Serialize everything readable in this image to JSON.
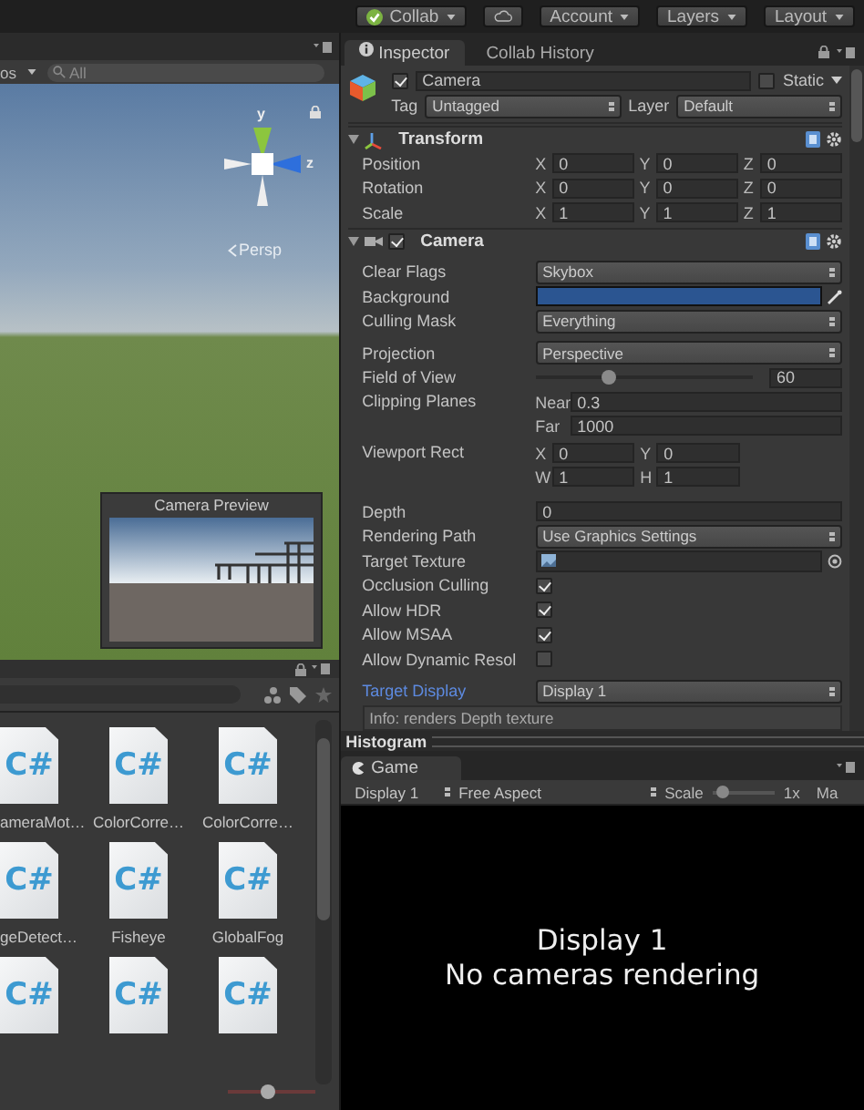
{
  "toolbar": [
    {
      "kind": "collab",
      "label": "Collab"
    },
    {
      "kind": "cloud"
    },
    {
      "kind": "menu",
      "label": "Account"
    },
    {
      "kind": "menu",
      "label": "Layers"
    },
    {
      "kind": "menu",
      "label": "Layout"
    }
  ],
  "scene": {
    "gizmos": "os",
    "search_placeholder": "All",
    "axes": [
      {
        "label": "y",
        "color": "#8cc63e"
      },
      {
        "label": "z",
        "color": "#2e6fdc"
      }
    ],
    "projection": "Persp",
    "preview_title": "Camera Preview"
  },
  "project": {
    "icon_size": {
      "level": 0.45
    },
    "files": [
      {
        "badge": "C#",
        "name": "ameraMot…"
      },
      {
        "badge": "C#",
        "name": "ColorCorre…"
      },
      {
        "badge": "C#",
        "name": "ColorCorre…"
      },
      {
        "badge": "C#",
        "name": "geDetect…"
      },
      {
        "badge": "C#",
        "name": "Fisheye"
      },
      {
        "badge": "C#",
        "name": "GlobalFog"
      },
      {
        "badge": "C#"
      },
      {
        "badge": "C#"
      },
      {
        "badge": "C#"
      }
    ]
  },
  "inspector": {
    "tabs": [
      {
        "label": "Inspector",
        "selected": true
      },
      {
        "label": "Collab History",
        "selected": false
      }
    ],
    "object": {
      "active": true,
      "name": "Camera",
      "static_label": "Static",
      "static": false,
      "tag_label": "Tag",
      "tag": "Untagged",
      "layer_label": "Layer",
      "layer": "Default"
    },
    "transform": {
      "title": "Transform",
      "expanded": true,
      "rows": [
        {
          "label": "Position",
          "fields": [
            {
              "axis": "X",
              "value": "0"
            },
            {
              "axis": "Y",
              "value": "0"
            },
            {
              "axis": "Z",
              "value": "0"
            }
          ]
        },
        {
          "label": "Rotation",
          "fields": [
            {
              "axis": "X",
              "value": "0"
            },
            {
              "axis": "Y",
              "value": "0"
            },
            {
              "axis": "Z",
              "value": "0"
            }
          ]
        },
        {
          "label": "Scale",
          "fields": [
            {
              "axis": "X",
              "value": "1"
            },
            {
              "axis": "Y",
              "value": "1"
            },
            {
              "axis": "Z",
              "value": "1"
            }
          ]
        }
      ]
    },
    "camera": {
      "title": "Camera",
      "expanded": true,
      "enabled": true,
      "groups": [
        {
          "rows": [
            {
              "kind": "dropdown",
              "label": "Clear Flags",
              "value": "Skybox"
            },
            {
              "kind": "color",
              "label": "Background",
              "color": "#2b5591"
            },
            {
              "kind": "dropdown",
              "label": "Culling Mask",
              "value": "Everything"
            }
          ]
        },
        {
          "rows": [
            {
              "kind": "dropdown",
              "label": "Projection",
              "value": "Perspective"
            },
            {
              "kind": "slider",
              "label": "Field of View",
              "level": 0.34,
              "value": "60"
            },
            {
              "kind": "stack",
              "label": "Clipping Planes",
              "fields": [
                {
                  "axis": "Near",
                  "value": "0.3"
                },
                {
                  "axis": "Far",
                  "value": "1000"
                }
              ]
            },
            {
              "kind": "grid",
              "label": "Viewport Rect",
              "fields": [
                {
                  "axis": "X",
                  "value": "0"
                },
                {
                  "axis": "Y",
                  "value": "0"
                },
                {
                  "axis": "W",
                  "value": "1"
                },
                {
                  "axis": "H",
                  "value": "1"
                }
              ]
            }
          ]
        },
        {
          "rows": [
            {
              "kind": "text",
              "label": "Depth",
              "value": "0"
            },
            {
              "kind": "dropdown",
              "label": "Rendering Path",
              "value": "Use Graphics Settings"
            },
            {
              "kind": "object",
              "label": "Target Texture"
            },
            {
              "kind": "checkbox",
              "label": "Occlusion Culling",
              "checked": true
            },
            {
              "kind": "checkbox",
              "label": "Allow HDR",
              "checked": true
            },
            {
              "kind": "checkbox",
              "label": "Allow MSAA",
              "checked": true
            },
            {
              "kind": "checkbox",
              "label": "Allow Dynamic Resol",
              "checked": false
            }
          ]
        },
        {
          "rows": [
            {
              "kind": "dropdown",
              "label": "Target Display",
              "value": "Display 1",
              "highlighted": true
            },
            {
              "kind": "info",
              "value": "Info: renders Depth texture"
            }
          ]
        }
      ]
    }
  },
  "histogram": {
    "title": "Histogram"
  },
  "game": {
    "tab": "Game",
    "display": "Display 1",
    "aspect": "Free Aspect",
    "scale_label": "Scale",
    "scale": {
      "level": 0.15
    },
    "scale_value": "1x",
    "cut_label": "Ma",
    "message": [
      "Display 1",
      "No cameras rendering"
    ]
  }
}
